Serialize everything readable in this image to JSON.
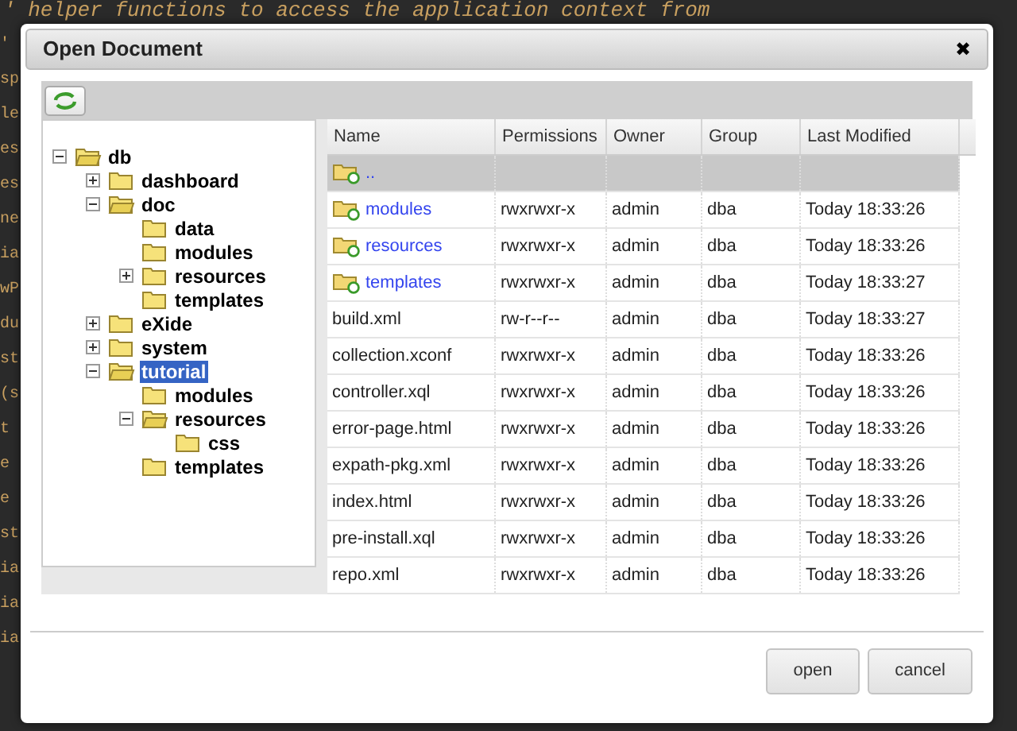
{
  "editor": {
    "lines": [
      {
        "text": "' helper functions to access the application context from"
      },
      {
        "text": "'"
      },
      {
        "text": "sp"
      },
      {
        "text": "le"
      },
      {
        "text": "es"
      },
      {
        "text": "es"
      },
      {
        "text": "ne"
      },
      {
        "text": "ia"
      },
      {
        "text": "wP"
      },
      {
        "text": "du"
      },
      {
        "text": "st"
      },
      {
        "text": "(s"
      },
      {
        "text": "t"
      },
      {
        "text": "e"
      },
      {
        "text": "e"
      },
      {
        "text": "st"
      },
      {
        "text": "ia"
      },
      {
        "text": "ia"
      },
      {
        "text": "ia"
      }
    ]
  },
  "dialog": {
    "title": "Open Document",
    "close": "✖",
    "tree": [
      {
        "label": "db",
        "expanded": true,
        "selected": false,
        "children": [
          {
            "label": "dashboard",
            "expanded": false,
            "selected": false
          },
          {
            "label": "doc",
            "expanded": true,
            "selected": false,
            "children": [
              {
                "label": "data",
                "selected": false
              },
              {
                "label": "modules",
                "selected": false
              },
              {
                "label": "resources",
                "expanded": false,
                "selected": false
              },
              {
                "label": "templates",
                "selected": false
              }
            ]
          },
          {
            "label": "eXide",
            "expanded": false,
            "selected": false
          },
          {
            "label": "system",
            "expanded": false,
            "selected": false
          },
          {
            "label": "tutorial",
            "expanded": true,
            "selected": true,
            "children": [
              {
                "label": "modules",
                "selected": false
              },
              {
                "label": "resources",
                "expanded": true,
                "selected": false,
                "children": [
                  {
                    "label": "css",
                    "selected": false
                  }
                ]
              },
              {
                "label": "templates",
                "selected": false
              }
            ]
          }
        ]
      }
    ],
    "table": {
      "columns": [
        "Name",
        "Permissions",
        "Owner",
        "Group",
        "Last Modified"
      ],
      "rows": [
        {
          "kind": "parent",
          "selected": true,
          "name": ".."
        },
        {
          "kind": "folder",
          "selected": false,
          "name": "modules",
          "permissions": "rwxrwxr-x",
          "owner": "admin",
          "group": "dba",
          "modified": "Today 18:33:26"
        },
        {
          "kind": "folder",
          "selected": false,
          "name": "resources",
          "permissions": "rwxrwxr-x",
          "owner": "admin",
          "group": "dba",
          "modified": "Today 18:33:26"
        },
        {
          "kind": "folder",
          "selected": false,
          "name": "templates",
          "permissions": "rwxrwxr-x",
          "owner": "admin",
          "group": "dba",
          "modified": "Today 18:33:27"
        },
        {
          "kind": "file",
          "selected": false,
          "name": "build.xml",
          "permissions": "rw-r--r--",
          "owner": "admin",
          "group": "dba",
          "modified": "Today 18:33:27"
        },
        {
          "kind": "file",
          "selected": false,
          "name": "collection.xconf",
          "permissions": "rwxrwxr-x",
          "owner": "admin",
          "group": "dba",
          "modified": "Today 18:33:26"
        },
        {
          "kind": "file",
          "selected": false,
          "name": "controller.xql",
          "permissions": "rwxrwxr-x",
          "owner": "admin",
          "group": "dba",
          "modified": "Today 18:33:26"
        },
        {
          "kind": "file",
          "selected": false,
          "name": "error-page.html",
          "permissions": "rwxrwxr-x",
          "owner": "admin",
          "group": "dba",
          "modified": "Today 18:33:26"
        },
        {
          "kind": "file",
          "selected": false,
          "name": "expath-pkg.xml",
          "permissions": "rwxrwxr-x",
          "owner": "admin",
          "group": "dba",
          "modified": "Today 18:33:26"
        },
        {
          "kind": "file",
          "selected": false,
          "name": "index.html",
          "permissions": "rwxrwxr-x",
          "owner": "admin",
          "group": "dba",
          "modified": "Today 18:33:26"
        },
        {
          "kind": "file",
          "selected": false,
          "name": "pre-install.xql",
          "permissions": "rwxrwxr-x",
          "owner": "admin",
          "group": "dba",
          "modified": "Today 18:33:26"
        },
        {
          "kind": "file",
          "selected": false,
          "name": "repo.xml",
          "permissions": "rwxrwxr-x",
          "owner": "admin",
          "group": "dba",
          "modified": "Today 18:33:26"
        }
      ]
    },
    "buttons": [
      "open",
      "cancel"
    ]
  }
}
